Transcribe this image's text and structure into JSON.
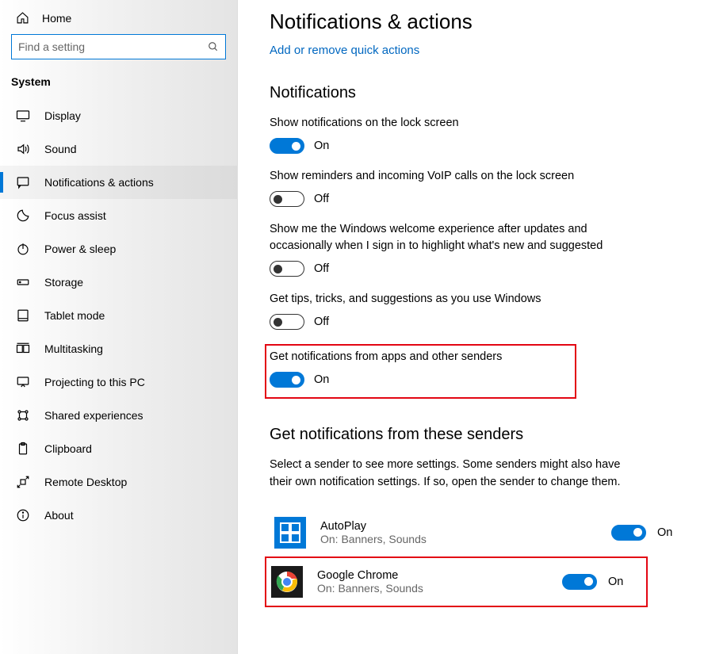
{
  "sidebar": {
    "home_label": "Home",
    "search_placeholder": "Find a setting",
    "category": "System",
    "items": [
      {
        "label": "Display"
      },
      {
        "label": "Sound"
      },
      {
        "label": "Notifications & actions"
      },
      {
        "label": "Focus assist"
      },
      {
        "label": "Power & sleep"
      },
      {
        "label": "Storage"
      },
      {
        "label": "Tablet mode"
      },
      {
        "label": "Multitasking"
      },
      {
        "label": "Projecting to this PC"
      },
      {
        "label": "Shared experiences"
      },
      {
        "label": "Clipboard"
      },
      {
        "label": "Remote Desktop"
      },
      {
        "label": "About"
      }
    ]
  },
  "main": {
    "title": "Notifications & actions",
    "quick_actions_link": "Add or remove quick actions",
    "notifications_section": "Notifications",
    "toggle_on": "On",
    "toggle_off": "Off",
    "settings": [
      {
        "label": "Show notifications on the lock screen",
        "on": true
      },
      {
        "label": "Show reminders and incoming VoIP calls on the lock screen",
        "on": false
      },
      {
        "label": "Show me the Windows welcome experience after updates and occasionally when I sign in to highlight what's new and suggested",
        "on": false
      },
      {
        "label": "Get tips, tricks, and suggestions as you use Windows",
        "on": false
      },
      {
        "label": "Get notifications from apps and other senders",
        "on": true
      }
    ],
    "senders_section": "Get notifications from these senders",
    "senders_desc": "Select a sender to see more settings. Some senders might also have their own notification settings. If so, open the sender to change them.",
    "senders": [
      {
        "name": "AutoPlay",
        "sub": "On: Banners, Sounds",
        "on": true
      },
      {
        "name": "Google Chrome",
        "sub": "On: Banners, Sounds",
        "on": true
      }
    ]
  }
}
